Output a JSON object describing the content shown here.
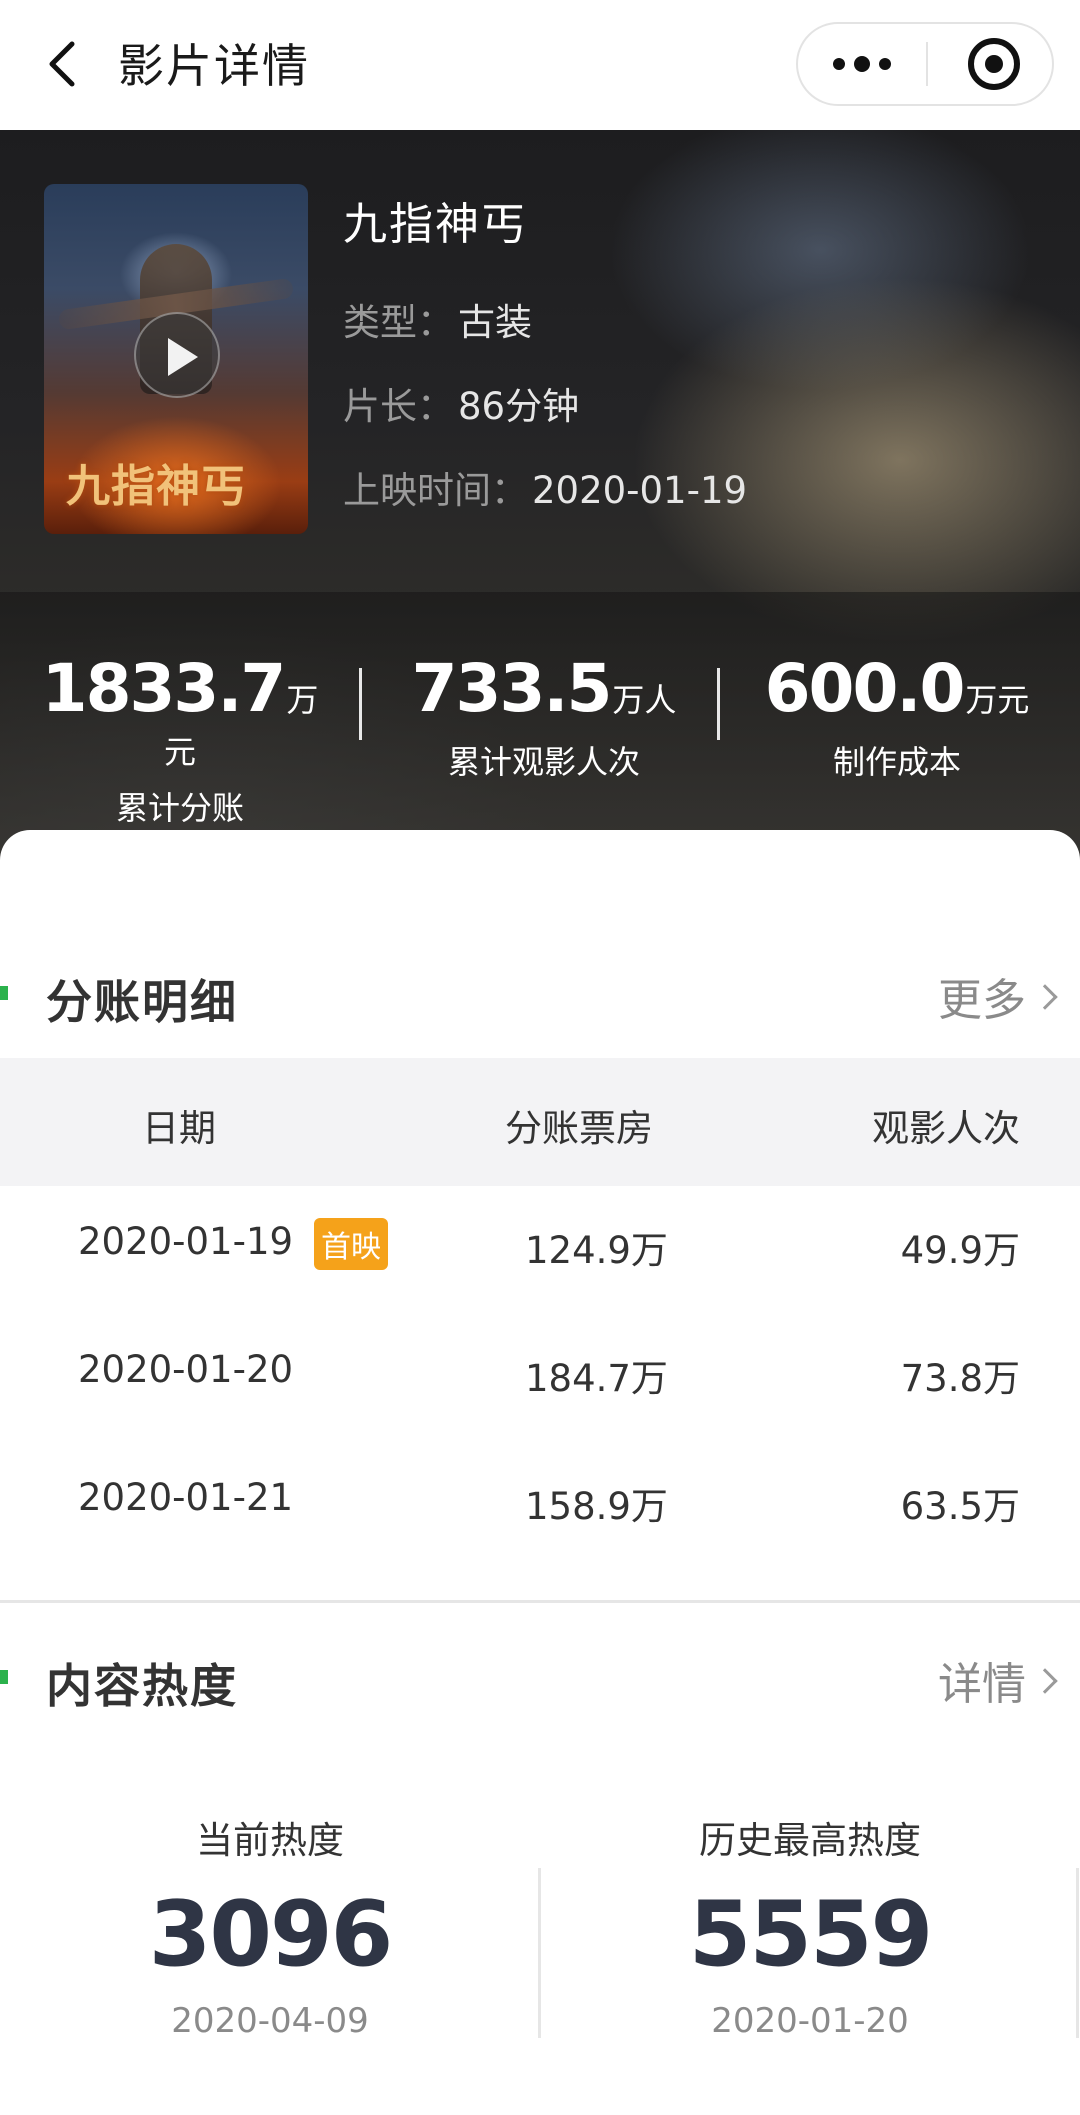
{
  "nav": {
    "title": "影片详情",
    "back_icon": "chevron-left-icon",
    "more_icon": "more-dots-icon",
    "target_icon": "record-target-icon"
  },
  "movie": {
    "name": "九指神丐",
    "poster_title": "九指神丐",
    "type_label": "类型：",
    "type_value": "古装",
    "duration_label": "片长：",
    "duration_value": "86分钟",
    "release_label": "上映时间：",
    "release_value": "2020-01-19"
  },
  "stats": [
    {
      "value": "1833.7",
      "unit": "万元",
      "label": "累计分账"
    },
    {
      "value": "733.5",
      "unit": "万人",
      "label": "累计观影人次"
    },
    {
      "value": "600.0",
      "unit": "万元",
      "label": "制作成本"
    }
  ],
  "split": {
    "title": "分账明细",
    "more": "更多",
    "columns": [
      "日期",
      "分账票房",
      "观影人次"
    ],
    "rows": [
      {
        "date": "2020-01-19",
        "badge": "首映",
        "box": "124.9万",
        "viewers": "49.9万"
      },
      {
        "date": "2020-01-20",
        "badge": "",
        "box": "184.7万",
        "viewers": "73.8万"
      },
      {
        "date": "2020-01-21",
        "badge": "",
        "box": "158.9万",
        "viewers": "63.5万"
      }
    ]
  },
  "heat": {
    "title": "内容热度",
    "more": "详情",
    "current": {
      "label": "当前热度",
      "value": "3096",
      "date": "2020-04-09"
    },
    "history": {
      "label": "历史最高热度",
      "value": "5559",
      "date": "2020-01-20"
    }
  },
  "colors": {
    "accent_green": "#2bb24c",
    "badge_orange": "#f5a21a",
    "heat_number": "#2f3545"
  }
}
